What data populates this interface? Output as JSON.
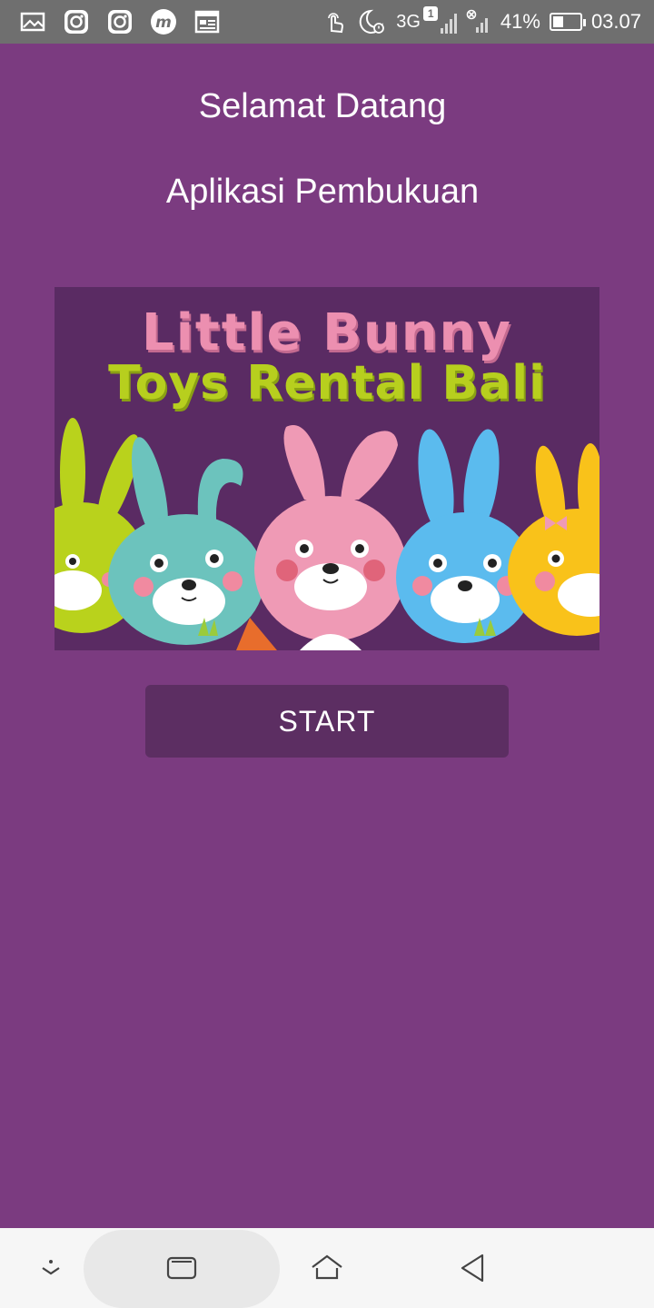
{
  "status_bar": {
    "left_icons": [
      "gallery-icon",
      "instagram-icon",
      "instagram-icon",
      "m-app-icon",
      "calendar-icon"
    ],
    "network": "3G",
    "sim_badge": "1",
    "battery_percent": "41%",
    "battery_level": 0.41,
    "time": "03.07"
  },
  "header": {
    "title": "Selamat Datang",
    "subtitle": "Aplikasi Pembukuan"
  },
  "banner": {
    "line1": "Little Bunny",
    "line2": "Toys Rental Bali",
    "colors": {
      "background": "#5a2b63",
      "line1": "#ec8fb0",
      "line2": "#b7cf1e"
    }
  },
  "actions": {
    "start_label": "START"
  },
  "nav_bar": {
    "buttons": [
      "hide-nav-icon",
      "recent-apps-icon",
      "home-icon",
      "back-icon"
    ]
  },
  "theme": {
    "background": "#7b3b80",
    "button": "#5c2e62",
    "status_bar": "#6f6f6f"
  }
}
